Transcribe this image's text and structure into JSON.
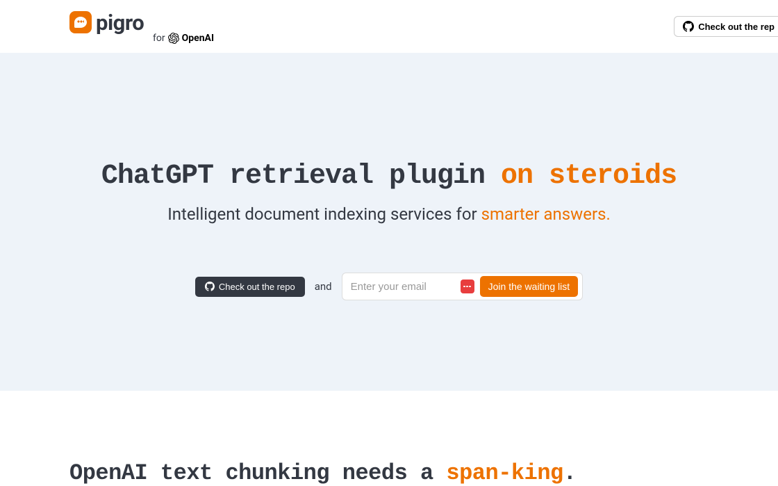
{
  "header": {
    "logo_text": "pigro",
    "logo_for": "for",
    "logo_openai": "OpenAI",
    "repo_button": "Check out the rep"
  },
  "hero": {
    "title_part1": "ChatGPT retrieval plugin ",
    "title_accent": "on steroids",
    "subtitle_part1": "Intelligent document indexing services for ",
    "subtitle_accent": "smarter answers.",
    "repo_button": "Check out the repo",
    "and_text": "and",
    "email_placeholder": "Enter your email",
    "join_button": "Join the waiting list"
  },
  "section2": {
    "title_part1": "OpenAI text chunking needs a ",
    "title_accent": "span-king",
    "title_part2": "."
  },
  "colors": {
    "accent": "#ED7200",
    "dark": "#333842",
    "hero_bg": "#EEF3F9",
    "red": "#E83E3E"
  }
}
